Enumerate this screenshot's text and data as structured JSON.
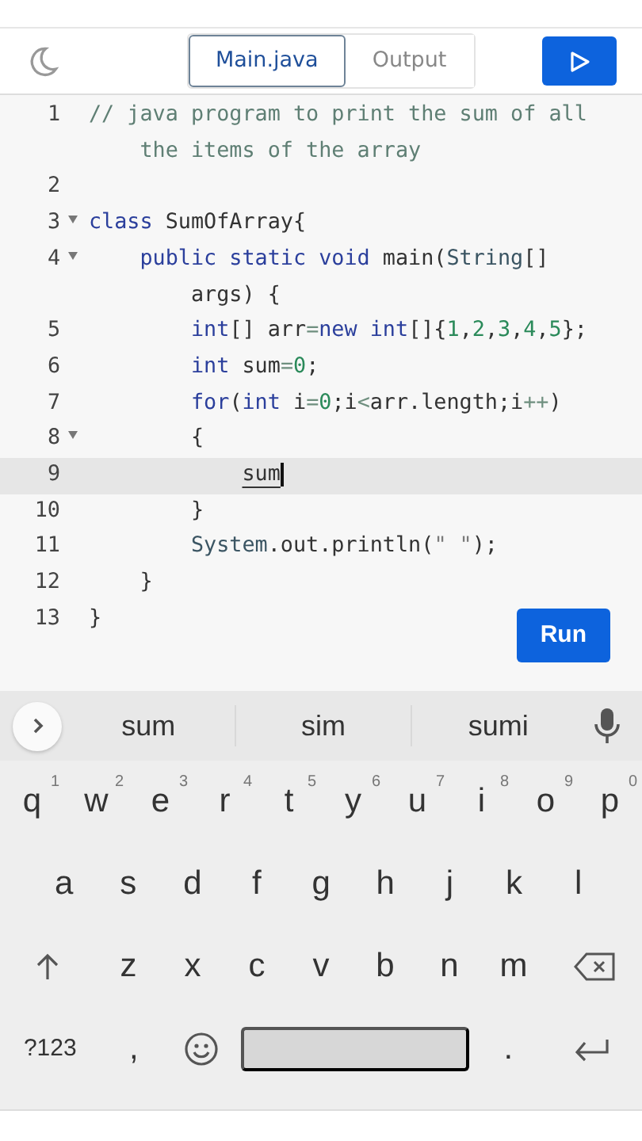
{
  "toolbar": {
    "tabs": [
      {
        "label": "Main.java",
        "selected": true
      },
      {
        "label": "Output",
        "selected": false
      }
    ]
  },
  "editor": {
    "lines": [
      {
        "number": "1",
        "fold": false,
        "active": false,
        "tokens": [
          {
            "t": "// java program to print the sum of all the items of the array",
            "kind": "comment"
          }
        ]
      },
      {
        "number": "2",
        "fold": false,
        "active": false
      },
      {
        "number": "3",
        "fold": true,
        "active": false,
        "tokens": [
          {
            "t": "class",
            "kind": "keyword"
          },
          {
            "t": " SumOfArray{",
            "kind": "plain"
          }
        ]
      },
      {
        "number": "4",
        "fold": true,
        "active": false,
        "tokens": [
          {
            "t": "    public static void",
            "kind": "keyword"
          },
          {
            "t": " main(",
            "kind": "plain"
          },
          {
            "t": "String",
            "kind": "type"
          },
          {
            "t": "[] args) {",
            "kind": "plain"
          }
        ]
      },
      {
        "number": "5",
        "fold": false,
        "active": false,
        "tokens": [
          {
            "t": "        int",
            "kind": "keyword"
          },
          {
            "t": "[] arr",
            "kind": "plain"
          },
          {
            "t": "=",
            "kind": "operator"
          },
          {
            "t": "new int",
            "kind": "keyword"
          },
          {
            "t": "[]{",
            "kind": "plain"
          },
          {
            "t": "1",
            "kind": "number"
          },
          {
            "t": ",",
            "kind": "plain"
          },
          {
            "t": "2",
            "kind": "number"
          },
          {
            "t": ",",
            "kind": "plain"
          },
          {
            "t": "3",
            "kind": "number"
          },
          {
            "t": ",",
            "kind": "plain"
          },
          {
            "t": "4",
            "kind": "number"
          },
          {
            "t": ",",
            "kind": "plain"
          },
          {
            "t": "5",
            "kind": "number"
          },
          {
            "t": "};",
            "kind": "plain"
          }
        ]
      },
      {
        "number": "6",
        "fold": false,
        "active": false,
        "tokens": [
          {
            "t": "        int",
            "kind": "keyword"
          },
          {
            "t": " sum",
            "kind": "plain"
          },
          {
            "t": "=",
            "kind": "operator"
          },
          {
            "t": "0",
            "kind": "number"
          },
          {
            "t": ";",
            "kind": "plain"
          }
        ]
      },
      {
        "number": "7",
        "fold": false,
        "active": false,
        "tokens": [
          {
            "t": "        for",
            "kind": "keyword"
          },
          {
            "t": "(",
            "kind": "plain"
          },
          {
            "t": "int",
            "kind": "keyword"
          },
          {
            "t": " i",
            "kind": "plain"
          },
          {
            "t": "=",
            "kind": "operator"
          },
          {
            "t": "0",
            "kind": "number"
          },
          {
            "t": ";i",
            "kind": "plain"
          },
          {
            "t": "<",
            "kind": "operator"
          },
          {
            "t": "arr.length;i",
            "kind": "plain"
          },
          {
            "t": "++",
            "kind": "operator"
          },
          {
            "t": ")",
            "kind": "plain"
          }
        ]
      },
      {
        "number": "8",
        "fold": true,
        "active": false,
        "tokens": [
          {
            "t": "        {",
            "kind": "plain"
          }
        ]
      },
      {
        "number": "9",
        "fold": false,
        "active": true,
        "tokens": [
          {
            "t": "            sum",
            "kind": "composing"
          }
        ]
      },
      {
        "number": "10",
        "fold": false,
        "active": false,
        "tokens": [
          {
            "t": "        }",
            "kind": "plain"
          }
        ]
      },
      {
        "number": "11",
        "fold": false,
        "active": false,
        "tokens": [
          {
            "t": "        System",
            "kind": "type"
          },
          {
            "t": ".out.println(",
            "kind": "plain"
          },
          {
            "t": "\" \"",
            "kind": "string"
          },
          {
            "t": ");",
            "kind": "plain"
          }
        ]
      },
      {
        "number": "12",
        "fold": false,
        "active": false,
        "tokens": [
          {
            "t": "    }",
            "kind": "plain"
          }
        ]
      },
      {
        "number": "13",
        "fold": false,
        "active": false,
        "tokens": [
          {
            "t": "}",
            "kind": "plain"
          }
        ]
      }
    ],
    "run_button": "Run"
  },
  "keyboard": {
    "suggestions": [
      "sum",
      "sim",
      "sumi"
    ],
    "rows": [
      {
        "keys": [
          {
            "kind": "letter",
            "label": "q",
            "hint": "1"
          },
          {
            "kind": "letter",
            "label": "w",
            "hint": "2"
          },
          {
            "kind": "letter",
            "label": "e",
            "hint": "3"
          },
          {
            "kind": "letter",
            "label": "r",
            "hint": "4"
          },
          {
            "kind": "letter",
            "label": "t",
            "hint": "5"
          },
          {
            "kind": "letter",
            "label": "y",
            "hint": "6"
          },
          {
            "kind": "letter",
            "label": "u",
            "hint": "7"
          },
          {
            "kind": "letter",
            "label": "i",
            "hint": "8"
          },
          {
            "kind": "letter",
            "label": "o",
            "hint": "9"
          },
          {
            "kind": "letter",
            "label": "p",
            "hint": "0"
          }
        ]
      },
      {
        "keys": [
          {
            "kind": "letter",
            "label": "a"
          },
          {
            "kind": "letter",
            "label": "s"
          },
          {
            "kind": "letter",
            "label": "d"
          },
          {
            "kind": "letter",
            "label": "f"
          },
          {
            "kind": "letter",
            "label": "g"
          },
          {
            "kind": "letter",
            "label": "h"
          },
          {
            "kind": "letter",
            "label": "j"
          },
          {
            "kind": "letter",
            "label": "k"
          },
          {
            "kind": "letter",
            "label": "l"
          }
        ]
      },
      {
        "keys": [
          {
            "kind": "shift"
          },
          {
            "kind": "letter",
            "label": "z"
          },
          {
            "kind": "letter",
            "label": "x"
          },
          {
            "kind": "letter",
            "label": "c"
          },
          {
            "kind": "letter",
            "label": "v"
          },
          {
            "kind": "letter",
            "label": "b"
          },
          {
            "kind": "letter",
            "label": "n"
          },
          {
            "kind": "letter",
            "label": "m"
          },
          {
            "kind": "backspace"
          }
        ]
      },
      {
        "keys": [
          {
            "kind": "symbols",
            "label": "?123"
          },
          {
            "kind": "letter",
            "label": ","
          },
          {
            "kind": "emoji"
          },
          {
            "kind": "space"
          },
          {
            "kind": "letter",
            "label": "."
          },
          {
            "kind": "enter"
          }
        ]
      }
    ]
  }
}
